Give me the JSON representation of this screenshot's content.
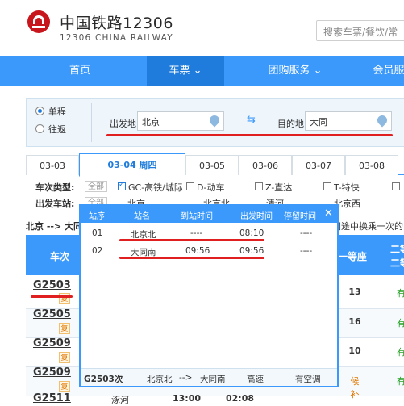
{
  "header": {
    "brand_cn": "中国铁路12306",
    "brand_en": "12306 CHINA RAILWAY",
    "search_placeholder": "搜索车票/餐饮/常"
  },
  "nav": {
    "items": [
      "首页",
      "车票 ⌄",
      "团购服务 ⌄",
      "会员服"
    ],
    "active_index": 1
  },
  "query": {
    "trip_types": [
      "单程",
      "往返"
    ],
    "from_label": "出发地",
    "from_value": "北京",
    "to_label": "目的地",
    "to_value": "大同"
  },
  "dates": [
    "03-03",
    "03-04 周四",
    "03-05",
    "03-06",
    "03-07",
    "03-08"
  ],
  "filters": {
    "type_label": "车次类型:",
    "all_chip": "全部",
    "types": [
      "GC-高铁/城际",
      "D-动车",
      "Z-直达",
      "T-特快"
    ],
    "station_label": "出发车站:",
    "stations": [
      "北京",
      "北京北",
      "清河",
      "北京西"
    ]
  },
  "route": {
    "text": "北京 --> 大同",
    "tail": "闼途中换乘一次的"
  },
  "table": {
    "col_train": "车次",
    "col_first": "一等座",
    "col_second": "二等",
    "col_second2": "二等",
    "rows": [
      {
        "train": "G2503",
        "first": "13",
        "second": "有",
        "tag": "复"
      },
      {
        "train": "G2505",
        "first": "16",
        "second": "有",
        "tag": "复"
      },
      {
        "train": "G2509",
        "first": "10",
        "second": "有",
        "tag": "复"
      },
      {
        "train": "G2509",
        "first": "候补",
        "second": "有",
        "tag": "复"
      }
    ],
    "bottom": {
      "train": "G2511",
      "station": "涿河",
      "depart": "13:00",
      "arrive": "02:08"
    }
  },
  "popup": {
    "headers": [
      "站序",
      "站名",
      "到站时间",
      "出发时间",
      "停留时间"
    ],
    "stops": [
      {
        "seq": "01",
        "name": "北京北",
        "arrive": "----",
        "depart": "08:10",
        "stay": "----"
      },
      {
        "seq": "02",
        "name": "大同南",
        "arrive": "09:56",
        "depart": "09:56",
        "stay": "----"
      }
    ],
    "footer": {
      "train": "G2503次",
      "from": "北京北",
      "arrow": "-->",
      "to": "大同南",
      "kind": "高速",
      "ac": "有空调"
    }
  }
}
